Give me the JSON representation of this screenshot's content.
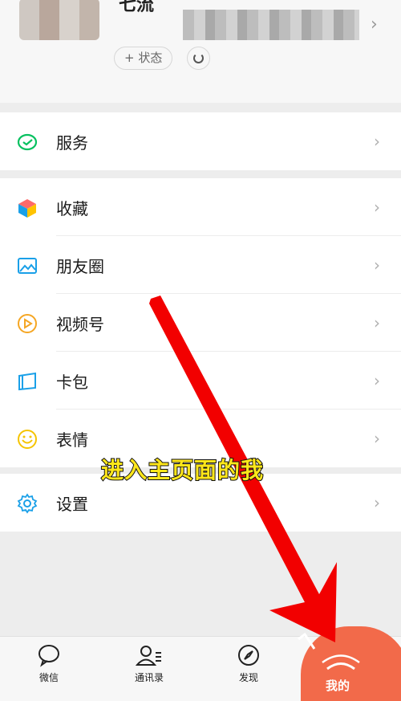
{
  "profile": {
    "name": "七流",
    "status_label": "+ 状态"
  },
  "services": {
    "label": "服务"
  },
  "menu": [
    {
      "label": "收藏"
    },
    {
      "label": "朋友圈"
    },
    {
      "label": "视频号"
    },
    {
      "label": "卡包"
    },
    {
      "label": "表情"
    }
  ],
  "settings": {
    "label": "设置"
  },
  "tabs": [
    {
      "label": "微信"
    },
    {
      "label": "通讯录"
    },
    {
      "label": "发现"
    },
    {
      "label": "我的"
    }
  ],
  "overlay": {
    "caption": "进入主页面的我"
  },
  "colors": {
    "accent_green": "#07c160",
    "icon_blue": "#1aa0e8",
    "highlight_red": "#f20000",
    "caption_yellow": "#ffe71a"
  }
}
